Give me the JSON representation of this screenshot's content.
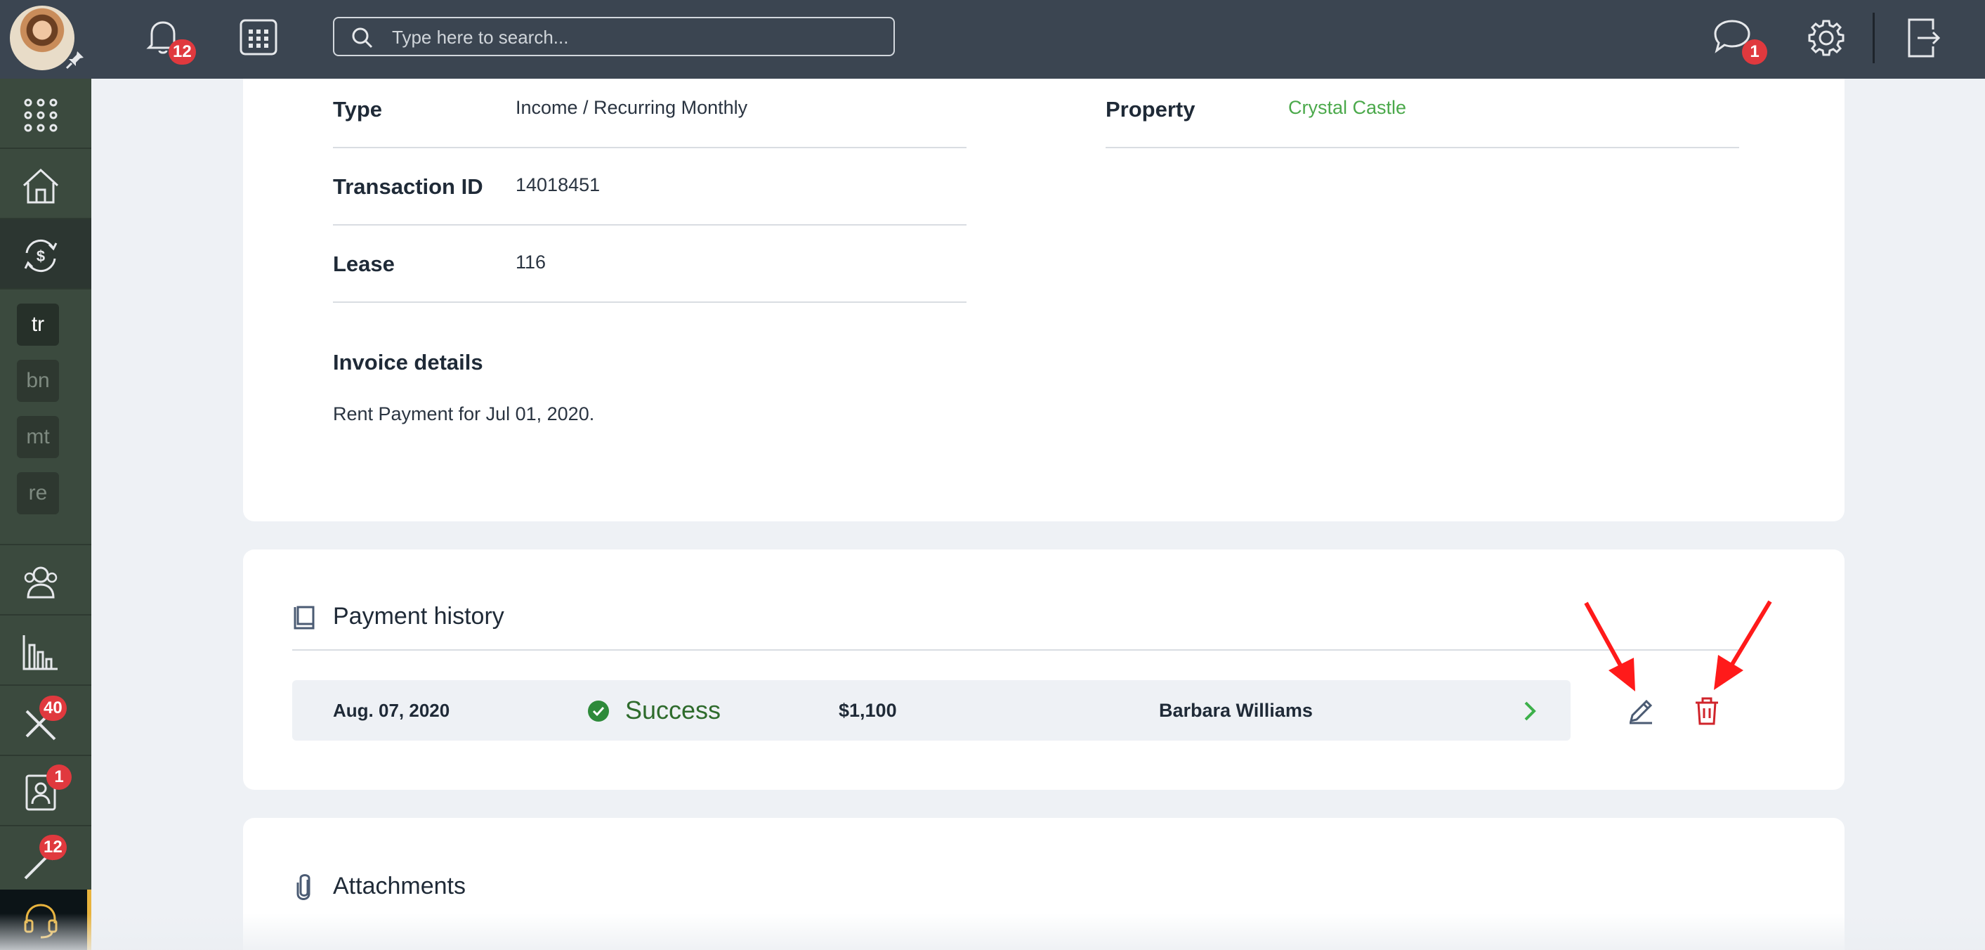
{
  "topbar": {
    "notifications_count": "12",
    "messages_count": "1",
    "search_placeholder": "Type here to search..."
  },
  "sidebar": {
    "chips": [
      "tr",
      "bn",
      "mt",
      "re"
    ],
    "maintenance_badge": "40",
    "tenants_badge": "1",
    "tools_badge": "12"
  },
  "details": {
    "type_label": "Type",
    "type_value": "Income / Recurring Monthly",
    "transaction_label": "Transaction ID",
    "transaction_value": "14018451",
    "lease_label": "Lease",
    "lease_value": "116",
    "property_label": "Property",
    "property_value": "Crystal Castle",
    "invoice_label": "Invoice details",
    "invoice_value": "Rent Payment for Jul 01, 2020."
  },
  "payment_history": {
    "title": "Payment history",
    "rows": [
      {
        "date": "Aug. 07, 2020",
        "status": "Success",
        "amount": "$1,100",
        "payer": "Barbara Williams"
      }
    ]
  },
  "attachments": {
    "title": "Attachments"
  },
  "colors": {
    "topbar": "#3b4551",
    "sidebar": "#3b4a3e",
    "success": "#2e8a3a",
    "delete": "#d0242b",
    "annotation_arrow": "#ff1a1a",
    "link": "#4ba94b"
  }
}
